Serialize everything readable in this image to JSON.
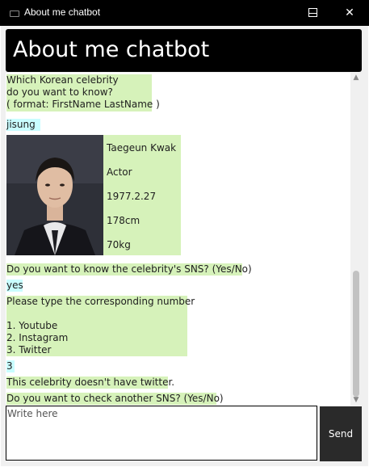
{
  "window": {
    "title": "About me chatbot",
    "minimize": "—",
    "maximize": "☐",
    "close": "✕"
  },
  "header": {
    "title": "About me chatbot"
  },
  "messages": [
    {
      "sender": "bot",
      "text": "Which Korean celebrity\ndo you want to know?\n( format: FirstName LastName )"
    },
    {
      "sender": "user",
      "text": "jisung"
    },
    {
      "sender": "bot",
      "text": "Do you want to know the celebrity's SNS? (Yes/No)"
    },
    {
      "sender": "user",
      "text": "yes"
    },
    {
      "sender": "bot",
      "text": "Please type the corresponding number\n\n1. Youtube\n2. Instagram\n3. Twitter"
    },
    {
      "sender": "user",
      "text": "3"
    },
    {
      "sender": "bot",
      "text": "This celebrity doesn't have twitter."
    },
    {
      "sender": "bot",
      "text": "Do you want to check another SNS? (Yes/No)"
    }
  ],
  "celebrity_card": {
    "photo": "celebrity-photo",
    "name": "Taegeun Kwak",
    "job": "Actor",
    "birth": "1977.2.27",
    "height": "178cm",
    "weight": "70kg"
  },
  "composer": {
    "placeholder": "Write here",
    "send_label": "Send"
  },
  "colors": {
    "bot_bubble": "#d6f2ba",
    "user_bubble": "#c9fdff",
    "header": "#000000"
  }
}
